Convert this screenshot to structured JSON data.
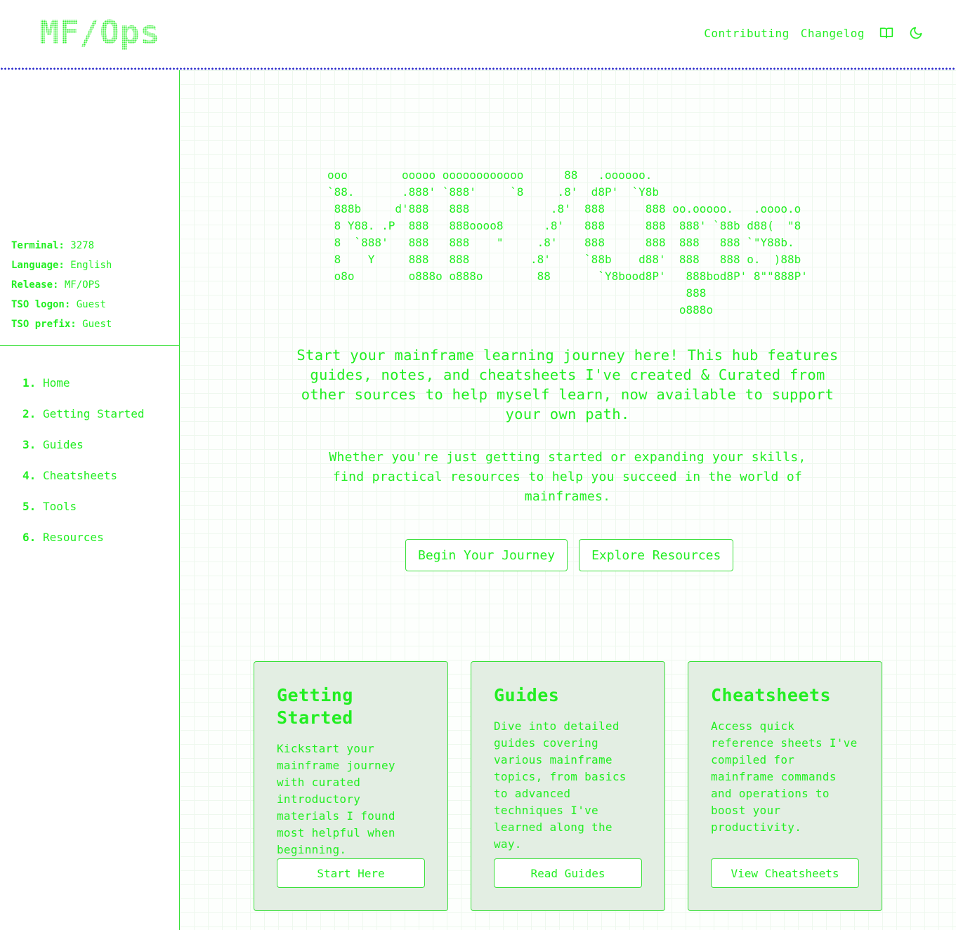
{
  "header": {
    "logo": "MF/Ops",
    "nav": {
      "contributing": "Contributing",
      "changelog": "Changelog"
    },
    "icons": [
      "book-icon",
      "moon-icon"
    ]
  },
  "sidebar": {
    "sysinfo": [
      {
        "key": "Terminal:",
        "value": "3278"
      },
      {
        "key": "Language:",
        "value": "English"
      },
      {
        "key": "Release:",
        "value": "MF/OPS"
      },
      {
        "key": "TSO logon:",
        "value": "Guest"
      },
      {
        "key": "TSO prefix:",
        "value": "Guest"
      }
    ],
    "nav": [
      {
        "num": "1.",
        "label": "Home"
      },
      {
        "num": "2.",
        "label": "Getting Started"
      },
      {
        "num": "3.",
        "label": "Guides"
      },
      {
        "num": "4.",
        "label": "Cheatsheets"
      },
      {
        "num": "5.",
        "label": "Tools"
      },
      {
        "num": "6.",
        "label": "Resources"
      }
    ]
  },
  "hero": {
    "ascii_art": "ooo        ooooo oooooooooooo      88   .oooooo.\n`88.       .888' `888'     `8     .8'  d8P'  `Y8b\n 888b     d'888   888            .8'  888      888 oo.ooooo.   .oooo.o\n 8 Y88. .P  888   888oooo8      .8'   888      888  888' `88b d88(  \"8\n 8  `888'   888   888    \"     .8'    888      888  888   888 `\"Y88b.\n 8    Y     888   888         .8'     `88b    d88'  888   888 o.  )88b\n o8o        o888o o888o        88       `Y8bood8P'   888bod8P' 8\"\"888P'\n                                                     888\n                                                    o888o",
    "intro": "Start your mainframe learning journey here! This hub features guides, notes, and cheatsheets I've created & Curated from other sources to help myself learn, now available to support your own path.",
    "intro2": "Whether you're just getting started or expanding your skills, find practical resources to help you succeed in the world of mainframes.",
    "cta_primary": "Begin Your Journey",
    "cta_secondary": "Explore Resources"
  },
  "cards": [
    {
      "title": "Getting Started",
      "body": "Kickstart your mainframe journey with curated introductory materials I found most helpful when beginning.",
      "button": "Start Here"
    },
    {
      "title": "Guides",
      "body": "Dive into detailed guides covering various mainframe topics, from basics to advanced techniques I've learned along the way.",
      "button": "Read Guides"
    },
    {
      "title": "Cheatsheets",
      "body": "Access quick reference sheets I've compiled for mainframe commands and operations to boost your productivity.",
      "button": "View Cheatsheets"
    }
  ],
  "colors": {
    "accent": "#22ee22",
    "divider": "#2b2bcc",
    "card_bg": "#e3eee3"
  }
}
